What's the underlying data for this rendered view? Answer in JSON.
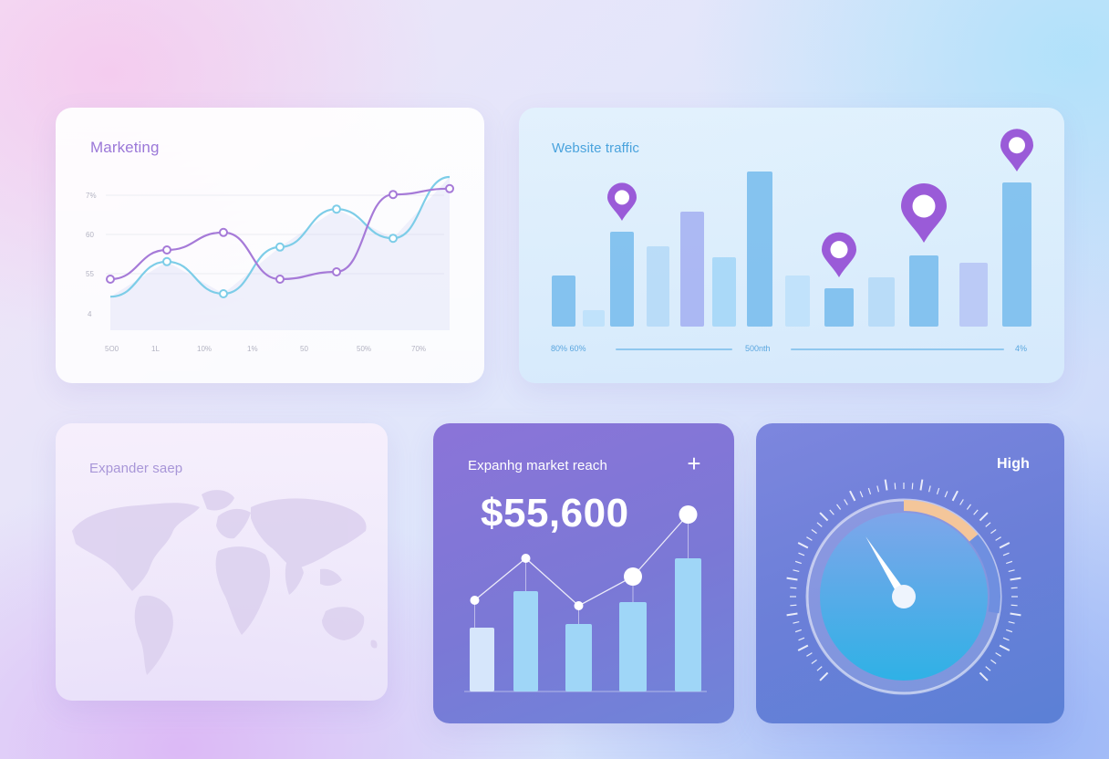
{
  "cards": {
    "marketing": {
      "title": "Marketing",
      "y_ticks": [
        "7%",
        "60",
        "55",
        "4"
      ],
      "x_ticks": [
        "5O0",
        "1L",
        "10%",
        "1%",
        "50",
        "50%",
        "70%"
      ]
    },
    "traffic": {
      "title": "Website traffic",
      "footer": {
        "left": "80%  60%",
        "middle": "500nth",
        "right": "4%"
      }
    },
    "map": {
      "title": "Expander saep"
    },
    "reach": {
      "title": "Expanhg market reach",
      "value": "$55,600",
      "add_icon": "plus-icon"
    },
    "gauge": {
      "title": "High",
      "level_fraction": 0.38,
      "colors": {
        "accent": "#f4c69a",
        "dial": "#2fb1e6"
      }
    }
  },
  "chart_data": [
    {
      "type": "line",
      "title": "Marketing",
      "x": [
        "5O0",
        "1L",
        "10%",
        "1%",
        "50",
        "50%",
        "70%"
      ],
      "series": [
        {
          "values": [
            18,
            42,
            20,
            52,
            78,
            58,
            100
          ],
          "color": "#7dcde8"
        },
        {
          "values": [
            30,
            50,
            62,
            30,
            35,
            88,
            92
          ],
          "color": "#a67ad8"
        }
      ]
    },
    {
      "type": "bar",
      "title": "Website traffic",
      "values": [
        28,
        9,
        52,
        44,
        63,
        38,
        85,
        28,
        21,
        27,
        39,
        35,
        79
      ],
      "markers_at": [
        2,
        8,
        10,
        12
      ],
      "colors": [
        "#7fc0ee",
        "#bfe2fb",
        "#7fc0ee",
        "#b7dbf8",
        "#a9b5f2",
        "#a8d8f8",
        "#7fc0ee",
        "#c0e2fb",
        "#7fc0ee",
        "#b7dbf8",
        "#7fc0ee",
        "#b9c8f5",
        "#7fc0ee"
      ]
    },
    {
      "type": "bar",
      "title": "Expanhg market reach",
      "values": [
        35,
        55,
        37,
        49,
        73
      ],
      "line": [
        50,
        73,
        47,
        63,
        97
      ]
    }
  ]
}
